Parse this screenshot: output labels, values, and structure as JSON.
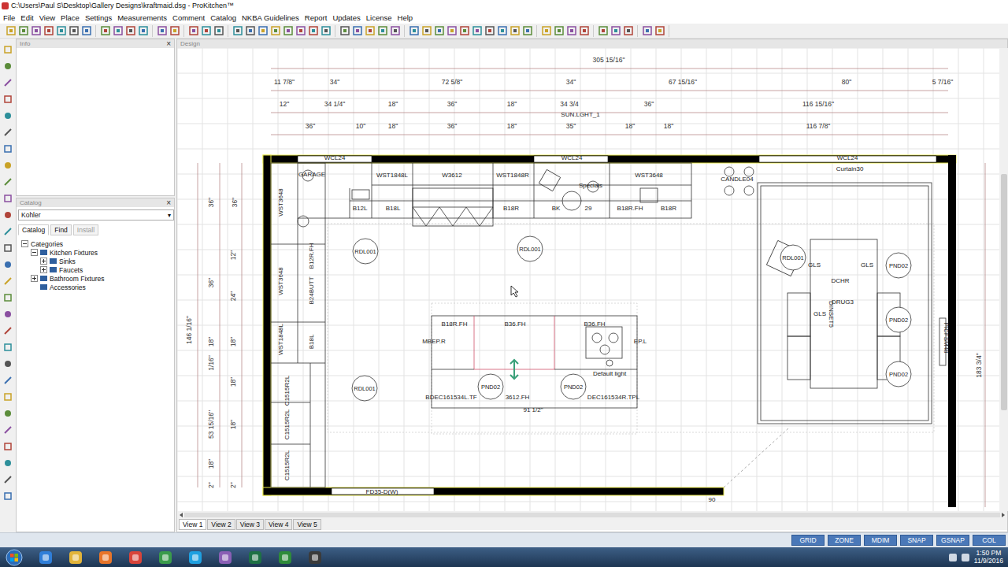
{
  "window": {
    "title": "C:\\Users\\Paul S\\Desktop\\Gallery Designs\\kraftmaid.dsg - ProKitchen™"
  },
  "menu": [
    "File",
    "Edit",
    "View",
    "Place",
    "Settings",
    "Measurements",
    "Comment",
    "Catalog",
    "NKBA Guidelines",
    "Report",
    "Updates",
    "License",
    "Help"
  ],
  "panels": {
    "info": {
      "title": "Info",
      "close": "×"
    },
    "catalog": {
      "title": "Catalog",
      "close": "×",
      "library": "Kohler",
      "dropdown_arrow": "▾",
      "tabs": [
        {
          "label": "Catalog",
          "selected": true,
          "disabled": false
        },
        {
          "label": "Find",
          "selected": false,
          "disabled": false
        },
        {
          "label": "Install",
          "selected": false,
          "disabled": true
        }
      ],
      "tree": [
        {
          "label": "Categories",
          "expandable": true,
          "expanded": true,
          "children": [
            {
              "label": "Kitchen Fixtures",
              "expandable": true,
              "expanded": true,
              "children": [
                {
                  "label": "Sinks",
                  "expandable": true,
                  "expanded": false,
                  "children": []
                },
                {
                  "label": "Faucets",
                  "expandable": true,
                  "expanded": false,
                  "children": []
                }
              ]
            },
            {
              "label": "Bathroom Fixtures",
              "expandable": true,
              "expanded": false,
              "children": []
            },
            {
              "label": "Accessories",
              "expandable": false,
              "expanded": false,
              "children": []
            }
          ]
        }
      ]
    }
  },
  "design": {
    "title": "Design",
    "top_dims": [
      "305 15/16\"",
      "11 7/8\"",
      "34\"",
      "72 5/8\"",
      "34\"",
      "67 15/16\"",
      "80\"",
      "5 7/16\"",
      "12\"",
      "34 1/4\"",
      "18\"",
      "36\"",
      "18\"",
      "34 3/4",
      "36\"",
      "116 15/16\"",
      "36\"",
      "10\"",
      "18\"",
      "36\"",
      "18\"",
      "35\"",
      "18\"",
      "18\"",
      "116 7/8\""
    ],
    "left_dims": [
      "36\"",
      "36\"",
      "12\"",
      "36\"",
      "24\"",
      "146 1/16\"",
      "18\"",
      "18\"",
      "1/16\"",
      "18\"",
      "53 15/16\"",
      "18\"",
      "18\"",
      "2\"",
      "2\""
    ],
    "right_dims": [
      "183 3/4\""
    ],
    "labels": [
      "WCL24",
      "WCL24",
      "WCL24",
      "Curtain30",
      "GARAGE",
      "WST1848L",
      "W3612",
      "WST1848R",
      "WST3648",
      "Specials",
      "B12L",
      "B18L",
      "B18R",
      "BK",
      "29",
      "B18R.FH",
      "B18R",
      "SUN.LGHT_1",
      "CANDLE04",
      "B12R.FH",
      "B24BUTT",
      "B18L",
      "WST3648",
      "WST3648",
      "WST1848L",
      "C1515R2L",
      "C1515R2L",
      "C1515R2L",
      "B18R.FH",
      "B36.FH",
      "B36.FH",
      "MBEP.R",
      "EP.L",
      "3612.FH",
      "BDEC161534L.TF",
      "DEC161534R.TPL",
      "91 1/2\"",
      "Default light",
      "DCHR",
      "DRUG3",
      "DINSET5",
      "GLS",
      "GLS",
      "GLS",
      "PICFSM48",
      "FD35-D(W)",
      "90"
    ],
    "lights": [
      "RDL001",
      "RDL001",
      "RDL001",
      "RDL001",
      "PND02",
      "PND02",
      "PND02",
      "PND02",
      "PND02"
    ]
  },
  "view_tabs": [
    {
      "label": "View 1",
      "selected": true
    },
    {
      "label": "View 2",
      "selected": false
    },
    {
      "label": "View 3",
      "selected": false
    },
    {
      "label": "View 4",
      "selected": false
    },
    {
      "label": "View 5",
      "selected": false
    }
  ],
  "status_buttons": [
    "GRID",
    "ZONE",
    "MDIM",
    "SNAP",
    "GSNAP",
    "COL"
  ],
  "taskbar": {
    "time": "1:50 PM",
    "date": "11/9/2016"
  }
}
